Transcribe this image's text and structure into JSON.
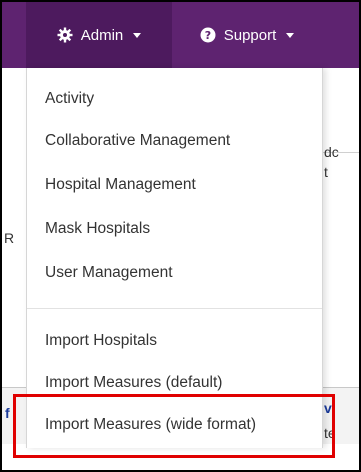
{
  "nav": {
    "admin_label": "Admin",
    "support_label": "Support",
    "bar_color": "#5e2370",
    "active_color": "#4d1a5e"
  },
  "admin_menu": {
    "items": [
      {
        "label": "Activity"
      },
      {
        "label": "Collaborative Management"
      },
      {
        "label": "Hospital Management"
      },
      {
        "label": "Mask Hospitals"
      },
      {
        "label": "User Management"
      },
      {
        "label": "Import Hospitals"
      },
      {
        "label": "Import Measures (default)"
      },
      {
        "label": "Import Measures (wide format)"
      }
    ],
    "highlighted_item": "Import Measures (wide format)",
    "highlight_color": "#e00000"
  },
  "background": {
    "fragment_dc": "dc",
    "fragment_t": "t",
    "fragment_r": "R",
    "fragment_vi": "vi",
    "fragment_te": "te",
    "fragment_f": "f"
  }
}
